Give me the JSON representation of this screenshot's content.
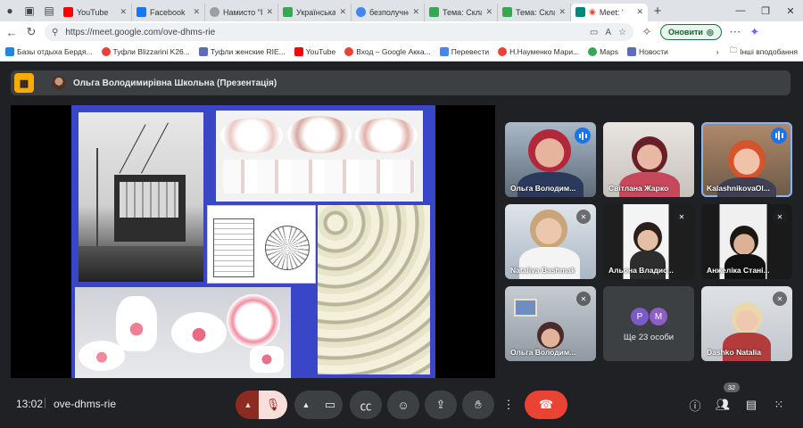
{
  "browser": {
    "tabs": [
      {
        "title": "YouTube",
        "color": "#ff0000"
      },
      {
        "title": "Facebook",
        "color": "#1877f2"
      },
      {
        "title": "Намисто \"П",
        "color": "#9aa0a6"
      },
      {
        "title": "Українська",
        "color": "#34a853"
      },
      {
        "title": "безполучне",
        "color": "#4285f4"
      },
      {
        "title": "Тема: Склад",
        "color": "#34a853"
      },
      {
        "title": "Тема: Склад",
        "color": "#34a853"
      },
      {
        "title": "Meet: '",
        "color": "#00897b"
      }
    ],
    "url": "https://meet.google.com/ove-dhms-rie",
    "update_label": "Оновити",
    "bookmarks": [
      {
        "label": "Базы отдыха Бердя...",
        "color": "#1e88e5"
      },
      {
        "label": "Туфли Blizzarini K26...",
        "color": "#ea4335"
      },
      {
        "label": "Туфли женские RIE...",
        "color": "#5c6bc0"
      },
      {
        "label": "YouTube",
        "color": "#ff0000"
      },
      {
        "label": "Вход – Google Акка...",
        "color": "#ea4335"
      },
      {
        "label": "Перевести",
        "color": "#4285f4"
      },
      {
        "label": "Н.Науменко Мари...",
        "color": "#ea4335"
      },
      {
        "label": "Maps",
        "color": "#34a853"
      },
      {
        "label": "Новости",
        "color": "#5c6bc0"
      }
    ],
    "other_bookmarks": "Інші вподобання"
  },
  "meet": {
    "presenter": "Ольга Володимирівна Школьна (Презентація)",
    "time": "13:02",
    "code": "ove-dhms-rie",
    "participant_count": "32",
    "more_people": "Ще 23 особи",
    "more_initials": [
      "P",
      "M"
    ],
    "participants": [
      {
        "name": "Ольга Володим...",
        "speaking": true,
        "active": false
      },
      {
        "name": "Світлана Жарко",
        "speaking": false,
        "active": false
      },
      {
        "name": "KalashnikovaOl...",
        "speaking": true,
        "active": true
      },
      {
        "name": "Nataliya Bashmak",
        "speaking": false,
        "active": false
      },
      {
        "name": "Альона Владис...",
        "speaking": false,
        "active": false
      },
      {
        "name": "Анжеліка Стані...",
        "speaking": false,
        "active": false
      },
      {
        "name": "Ольга Володим...",
        "speaking": false,
        "active": false
      },
      {
        "name": "Dashko Natalia",
        "speaking": false,
        "active": false
      }
    ]
  },
  "icons": [
    "presentation-icon",
    "mic-off-icon",
    "camera-icon",
    "captions-icon",
    "emoji-icon",
    "present-icon",
    "raise-hand-icon",
    "more-icon",
    "end-call-icon",
    "info-icon",
    "people-icon",
    "chat-icon",
    "activities-icon"
  ],
  "colors": {
    "accent": "#8ab4f8",
    "danger": "#ea4335",
    "mic_off_bg": "#f9dedc",
    "background": "#202124"
  }
}
